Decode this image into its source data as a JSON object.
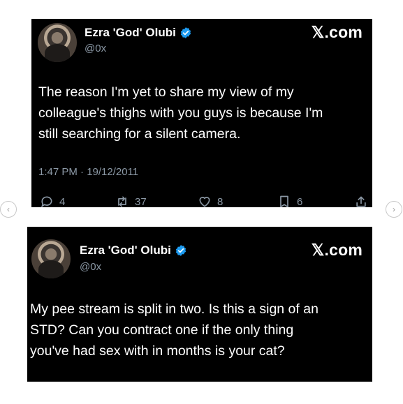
{
  "tweets": [
    {
      "name": "Ezra 'God' Olubi",
      "handle": "@0x",
      "brand": "𝕏.com",
      "lines": [
        "The reason I'm yet to share my view of my",
        "colleague's thighs with you guys is because I'm",
        "still searching for a silent camera."
      ],
      "timestamp": "1:47 PM · 19/12/2011",
      "actions": {
        "replies": "4",
        "reposts": "37",
        "likes": "8",
        "bookmarks": "6"
      }
    },
    {
      "name": "Ezra 'God' Olubi",
      "handle": "@0x",
      "brand": "𝕏.com",
      "lines": [
        "My pee stream is split in two. Is this a sign of an",
        "STD? Can you contract one if the only thing",
        "you've had sex with in months is your cat?"
      ]
    }
  ],
  "carousel": {
    "prev_icon": "chevron-left-icon",
    "next_icon": "chevron-right-icon"
  },
  "colors": {
    "verified": "#1d9bf0",
    "muted": "#8b98a5",
    "card_bg": "#000000"
  }
}
